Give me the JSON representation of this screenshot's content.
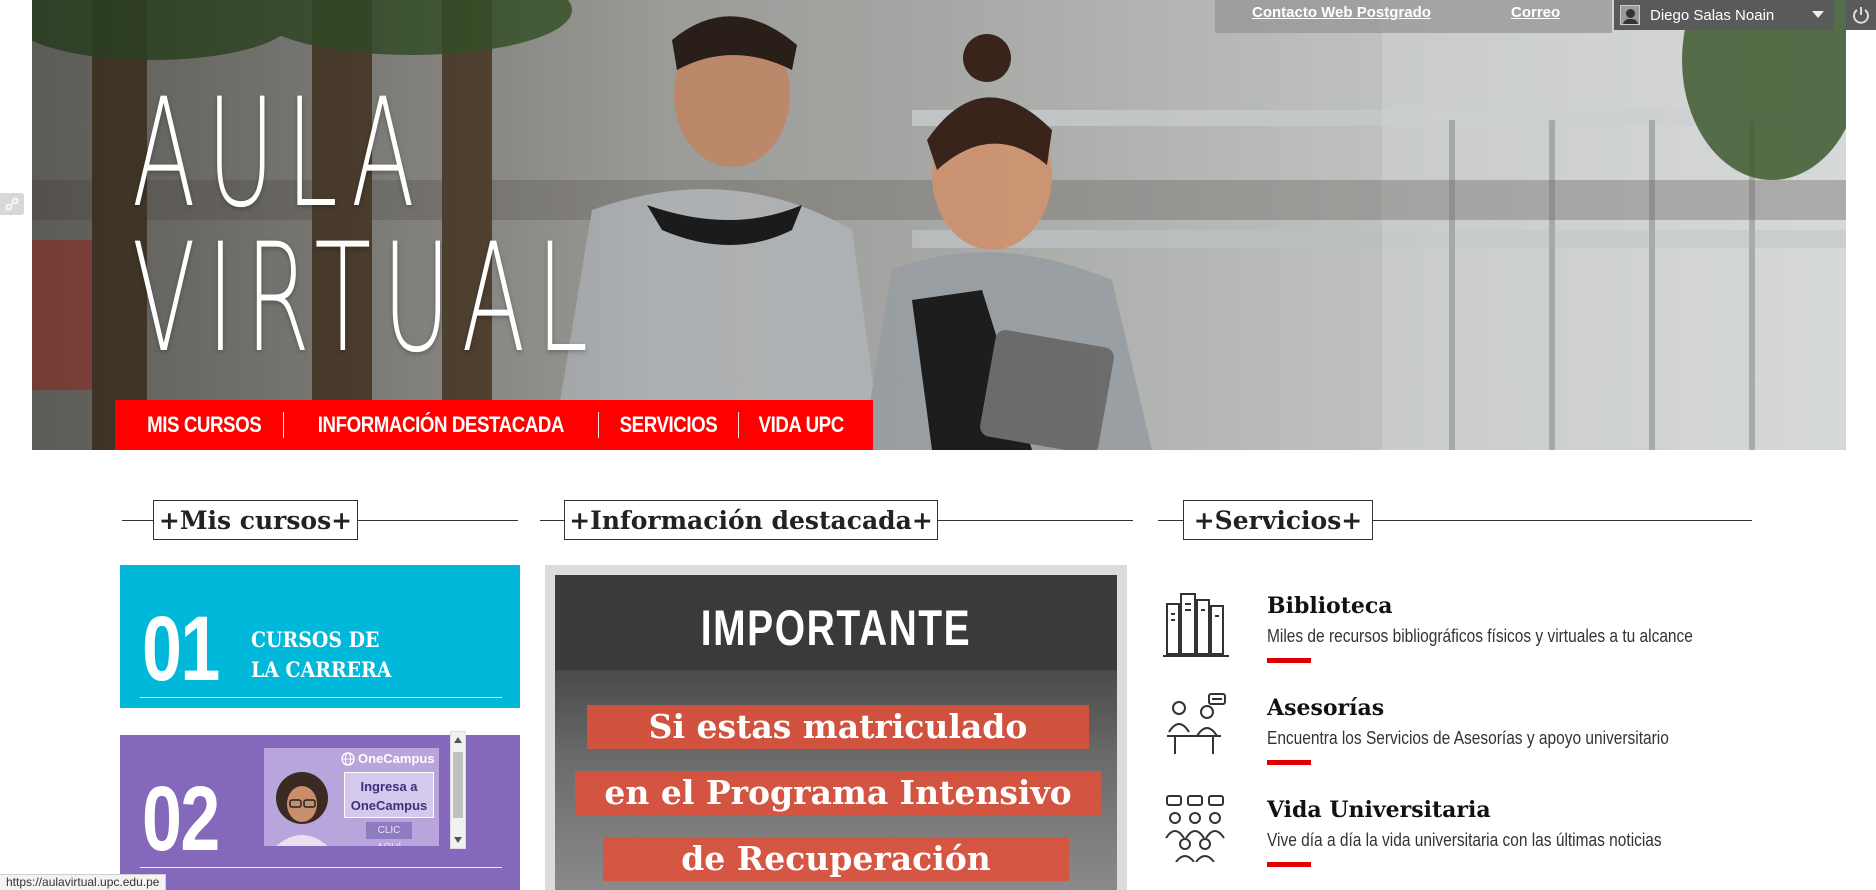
{
  "topbar": {
    "contacto_link": "Contacto Web Postgrado",
    "correo_link": "Correo",
    "user_name": "Diego Salas Noain"
  },
  "hero": {
    "title_line1": "AULA",
    "title_line2": "VIRTUAL",
    "nav": [
      "MIS CURSOS",
      "INFORMACIÓN DESTACADA",
      "SERVICIOS",
      "VIDA UPC"
    ]
  },
  "sections": {
    "cursos_title": "+Mis cursos+",
    "info_title": "+Información destacada+",
    "servicios_title": "+Servicios+"
  },
  "courses": [
    {
      "number": "01",
      "label_line1": "CURSOS DE",
      "label_line2": "LA CARRERA",
      "color": "#00b8d9"
    },
    {
      "number": "02",
      "color": "#8468bc",
      "promo": {
        "brand": "OneCampus",
        "card_line1": "Ingresa a",
        "card_line2": "OneCampus",
        "button": "CLIC AQUÍ"
      }
    }
  ],
  "info": {
    "heading": "IMPORTANTE",
    "lines": [
      "Si estas matriculado",
      "en el Programa Intensivo",
      "de Recuperación"
    ]
  },
  "services": [
    {
      "title": "Biblioteca",
      "desc": "Miles de recursos bibliográficos físicos y virtuales a tu alcance",
      "icon": "books-icon"
    },
    {
      "title": "Asesorías",
      "desc": "Encuentra los Servicios de Asesorías y apoyo universitario",
      "icon": "advisory-icon"
    },
    {
      "title": "Vida Universitaria",
      "desc": "Vive día a día la vida universitaria con las últimas noticias",
      "icon": "community-icon"
    }
  ],
  "status_url": "https://aulavirtual.upc.edu.pe",
  "colors": {
    "accent_red": "#ff0000",
    "cyan": "#00b8d9",
    "purple": "#8468bc"
  }
}
